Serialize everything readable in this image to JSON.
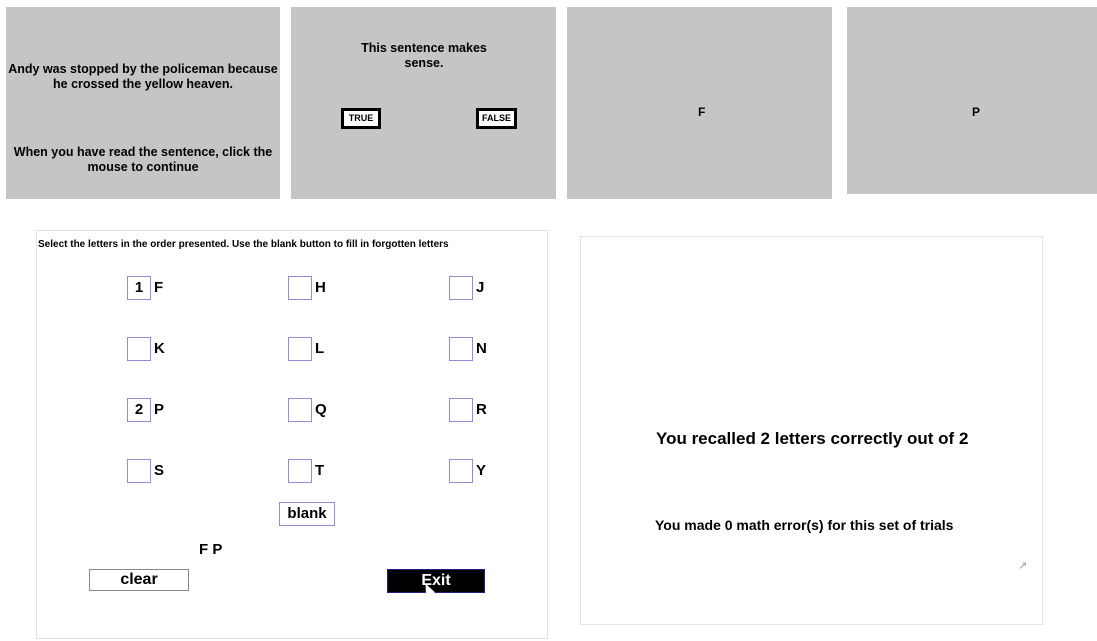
{
  "panel_sentence": {
    "sentence": "Andy was stopped by the policeman because he crossed the yellow heaven.",
    "instruction": "When you have read the sentence, click the mouse to continue"
  },
  "panel_judgment": {
    "question": "This sentence makes sense.",
    "true_label": "TRUE",
    "false_label": "FALSE"
  },
  "panel_letter_1": {
    "letter": "F"
  },
  "panel_letter_2": {
    "letter": "P"
  },
  "recall": {
    "instruction": "Select the letters in the order presented. Use the blank button to fill in forgotten letters",
    "letters": [
      {
        "label": "F",
        "order": "1"
      },
      {
        "label": "H",
        "order": ""
      },
      {
        "label": "J",
        "order": ""
      },
      {
        "label": "K",
        "order": ""
      },
      {
        "label": "L",
        "order": ""
      },
      {
        "label": "N",
        "order": ""
      },
      {
        "label": "P",
        "order": "2"
      },
      {
        "label": "Q",
        "order": ""
      },
      {
        "label": "R",
        "order": ""
      },
      {
        "label": "S",
        "order": ""
      },
      {
        "label": "T",
        "order": ""
      },
      {
        "label": "Y",
        "order": ""
      }
    ],
    "blank_label": "blank",
    "sequence": "F P",
    "clear_label": "clear",
    "exit_label": "Exit"
  },
  "result": {
    "recall_message": "You recalled 2 letters correctly out of 2",
    "math_message": "You made 0 math error(s) for this set of trials"
  }
}
